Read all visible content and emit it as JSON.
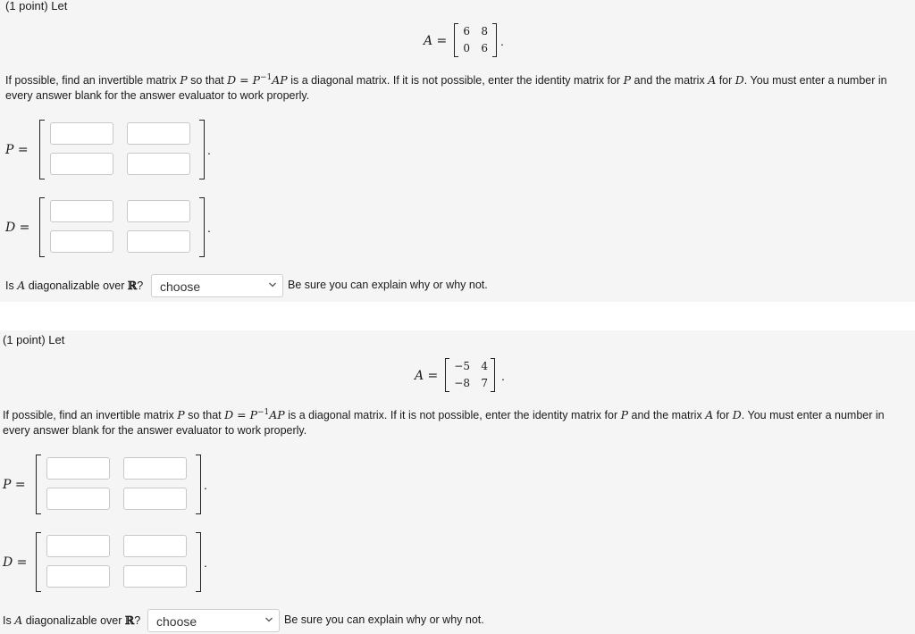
{
  "problems": [
    {
      "header": "(1 point) Let",
      "a_label": "A =",
      "matrix_a": [
        [
          "6",
          "8"
        ],
        [
          "0",
          "6"
        ]
      ],
      "period": ".",
      "instructions": [
        {
          "t": "If possible, find an invertible matrix ",
          "m": false
        },
        {
          "t": "P",
          "m": true
        },
        {
          "t": " so that ",
          "m": false
        },
        {
          "t": "D = P",
          "m": true
        },
        {
          "t": "−1",
          "m": "sup"
        },
        {
          "t": "AP",
          "m": true
        },
        {
          "t": " is a diagonal matrix. If it is not possible, enter the identity matrix for ",
          "m": false
        },
        {
          "t": "P",
          "m": true
        },
        {
          "t": " and the matrix ",
          "m": false
        },
        {
          "t": "A",
          "m": true
        },
        {
          "t": " for ",
          "m": false
        },
        {
          "t": "D",
          "m": true
        },
        {
          "t": ". You must enter a number in every answer blank for the answer evaluator to work properly.",
          "m": false
        }
      ],
      "p_label": "P =",
      "d_label": "D =",
      "p_values": [
        "",
        "",
        "",
        ""
      ],
      "d_values": [
        "",
        "",
        "",
        ""
      ],
      "question_prefix": "Is ",
      "question_var": "A",
      "question_mid": " diagonalizable over ",
      "question_R": "ℝ",
      "question_suffix": "?",
      "select_value": "choose",
      "hint": "Be sure you can explain why or why not."
    },
    {
      "header": "(1 point) Let",
      "a_label": "A =",
      "matrix_a": [
        [
          "−5",
          "4"
        ],
        [
          "−8",
          "7"
        ]
      ],
      "period": ".",
      "instructions": [
        {
          "t": "If possible, find an invertible matrix ",
          "m": false
        },
        {
          "t": "P",
          "m": true
        },
        {
          "t": " so that ",
          "m": false
        },
        {
          "t": "D = P",
          "m": true
        },
        {
          "t": "−1",
          "m": "sup"
        },
        {
          "t": "AP",
          "m": true
        },
        {
          "t": " is a diagonal matrix. If it is not possible, enter the identity matrix for ",
          "m": false
        },
        {
          "t": "P",
          "m": true
        },
        {
          "t": " and the matrix ",
          "m": false
        },
        {
          "t": "A",
          "m": true
        },
        {
          "t": " for ",
          "m": false
        },
        {
          "t": "D",
          "m": true
        },
        {
          "t": ". You must enter a number in every answer blank for the answer evaluator to work properly.",
          "m": false
        }
      ],
      "p_label": "P =",
      "d_label": "D =",
      "p_values": [
        "",
        "",
        "",
        ""
      ],
      "d_values": [
        "",
        "",
        "",
        ""
      ],
      "question_prefix": "Is ",
      "question_var": "A",
      "question_mid": " diagonalizable over ",
      "question_R": "ℝ",
      "question_suffix": "?",
      "select_value": "choose",
      "hint": "Be sure you can explain why or why not."
    }
  ],
  "icons": {
    "select_arrow": "chevron-down-icon"
  }
}
